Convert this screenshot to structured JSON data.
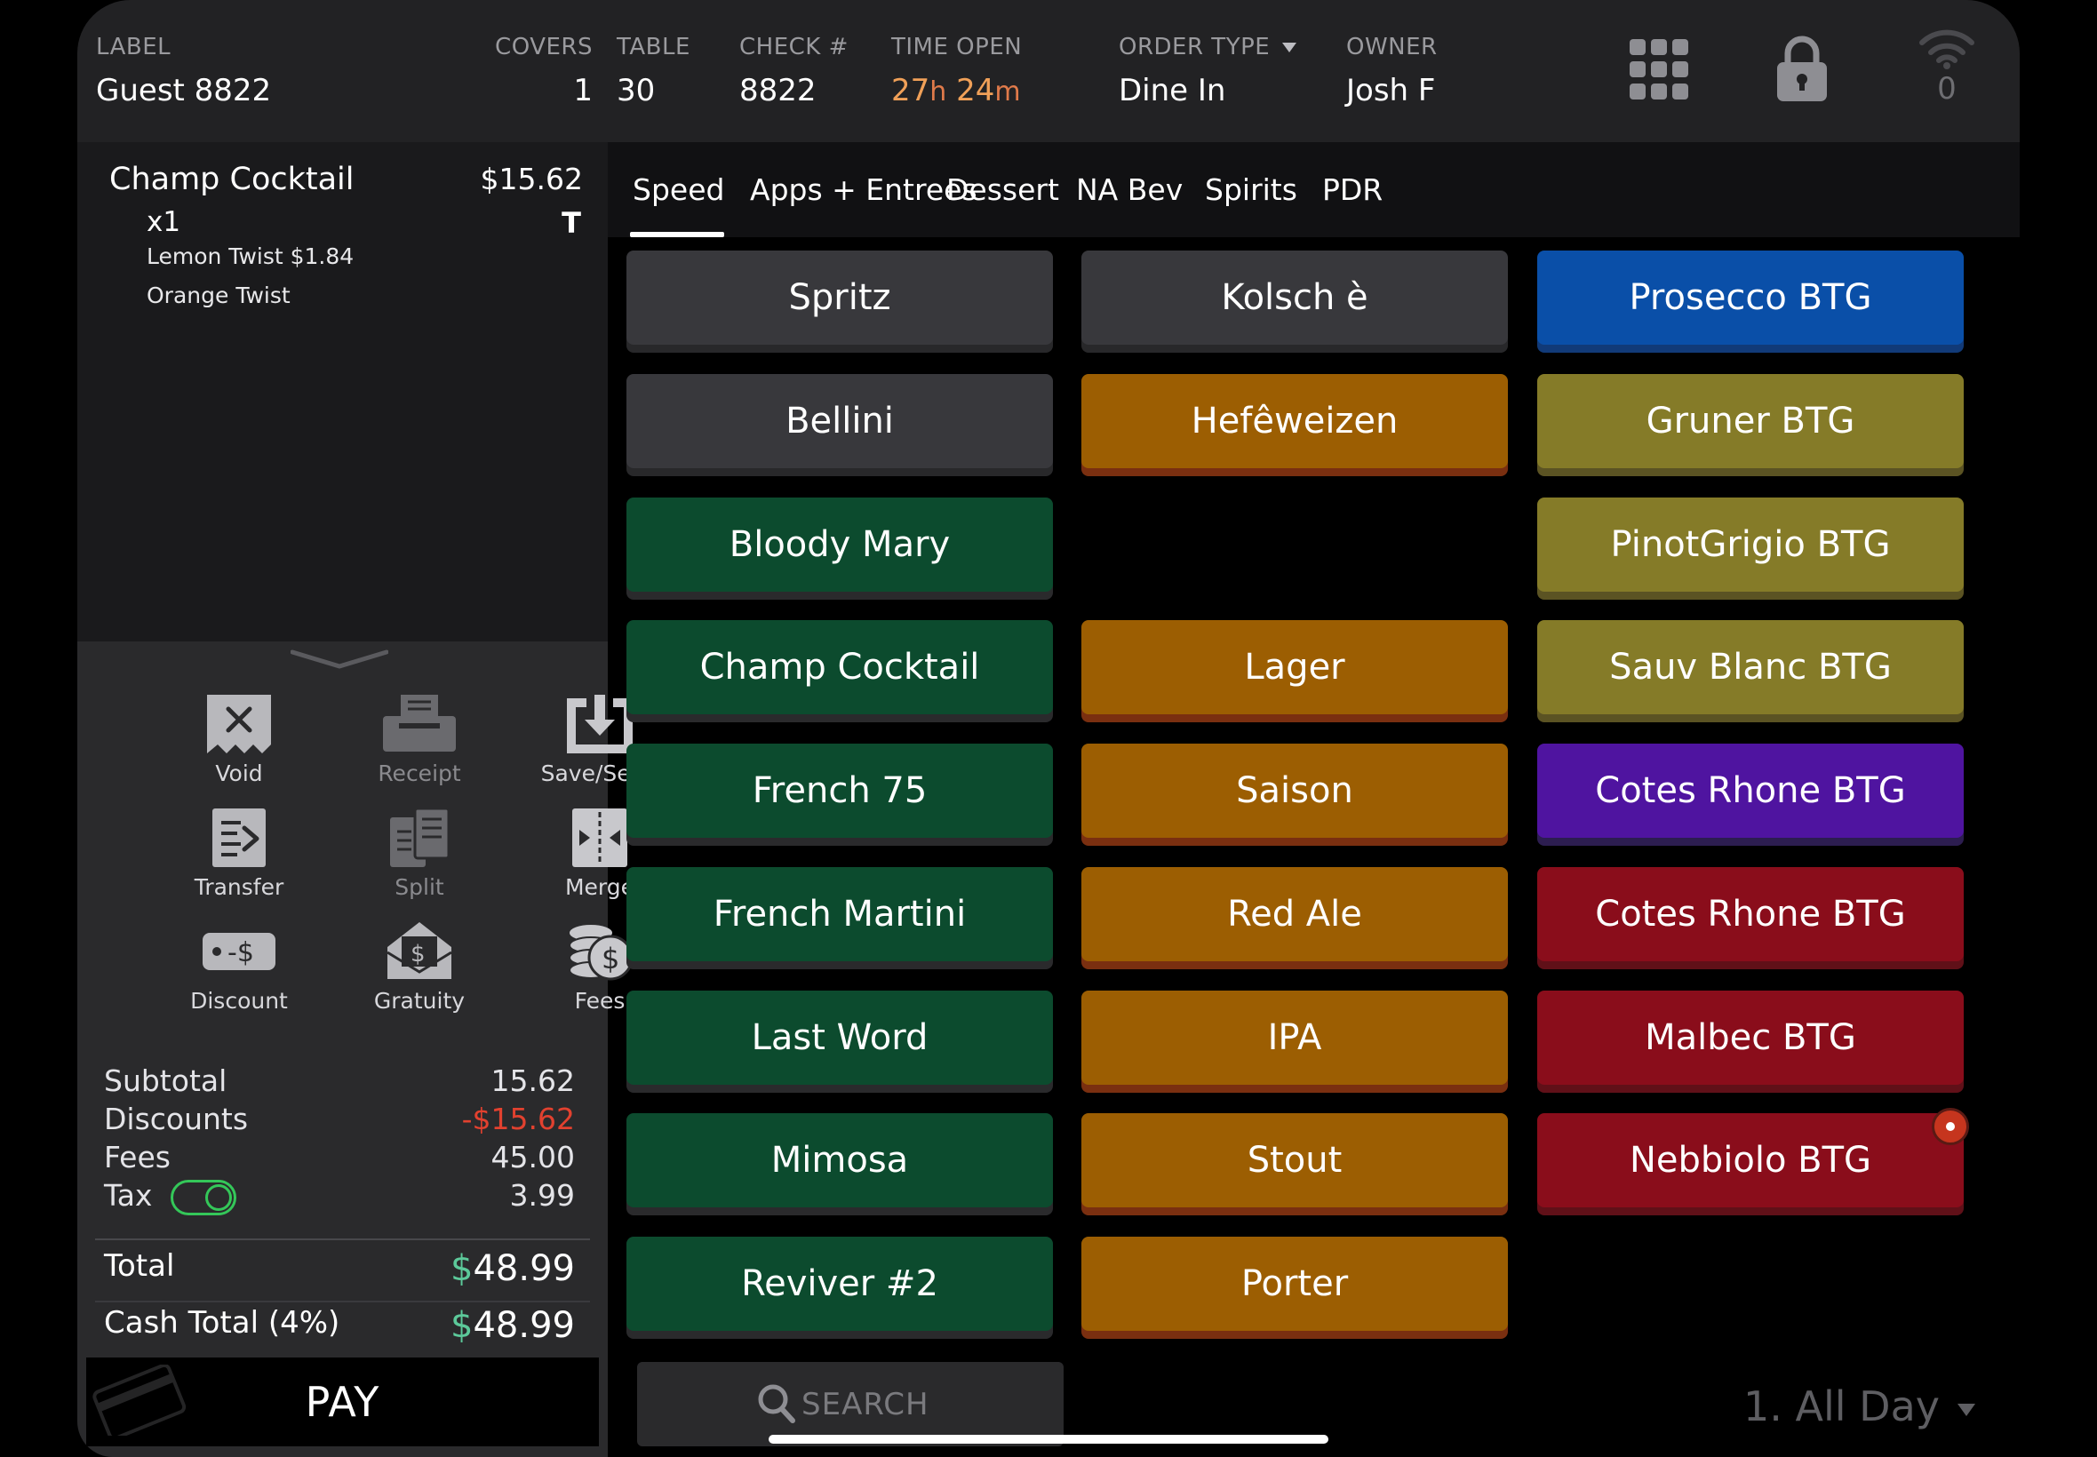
{
  "header": {
    "label": {
      "title": "LABEL",
      "value": "Guest 8822"
    },
    "covers": {
      "title": "COVERS",
      "value": "1"
    },
    "table": {
      "title": "TABLE",
      "value": "30"
    },
    "check": {
      "title": "CHECK #",
      "value": "8822"
    },
    "time_open": {
      "title": "TIME OPEN",
      "hours": "27",
      "h_unit": "h",
      "minutes": "24",
      "m_unit": "m"
    },
    "order_type": {
      "title": "ORDER TYPE",
      "value": "Dine In"
    },
    "owner": {
      "title": "OWNER",
      "value": "Josh F"
    },
    "wifi_count": "0",
    "icons": [
      "grid-icon",
      "lock-icon",
      "wifi-icon"
    ]
  },
  "order": {
    "items": [
      {
        "name": "Champ Cocktail",
        "price": "$15.62",
        "qty": "x1",
        "flag": "T",
        "modifiers": [
          "Lemon Twist $1.84",
          "Orange Twist"
        ]
      }
    ]
  },
  "actions": [
    {
      "label": "Void",
      "icon": "void-icon",
      "enabled": true
    },
    {
      "label": "Receipt",
      "icon": "receipt-icon",
      "enabled": false
    },
    {
      "label": "Save/Send",
      "icon": "save-send-icon",
      "enabled": true
    },
    {
      "label": "Transfer",
      "icon": "transfer-icon",
      "enabled": true
    },
    {
      "label": "Split",
      "icon": "split-icon",
      "enabled": false
    },
    {
      "label": "Merge",
      "icon": "merge-icon",
      "enabled": true
    },
    {
      "label": "Discount",
      "icon": "discount-icon",
      "enabled": true
    },
    {
      "label": "Gratuity",
      "icon": "gratuity-icon",
      "enabled": true
    },
    {
      "label": "Fees",
      "icon": "fees-icon",
      "enabled": true
    }
  ],
  "totals": {
    "subtotal": {
      "label": "Subtotal",
      "value": "15.62"
    },
    "discounts": {
      "label": "Discounts",
      "value": "-$15.62"
    },
    "fees": {
      "label": "Fees",
      "value": "45.00"
    },
    "tax": {
      "label": "Tax",
      "value": "3.99",
      "enabled": true
    },
    "total": {
      "label": "Total",
      "currency": "$",
      "value": "48.99"
    },
    "cash_total": {
      "label": "Cash Total (4%)",
      "currency": "$",
      "value": "48.99"
    }
  },
  "pay_label": "PAY",
  "tabs": [
    {
      "label": "Speed",
      "active": true
    },
    {
      "label": "Apps + Entrees"
    },
    {
      "label": "Dessert"
    },
    {
      "label": "NA Bev"
    },
    {
      "label": "Spirits"
    },
    {
      "label": "PDR"
    }
  ],
  "menu": {
    "col1": [
      "Spritz",
      "Bellini",
      "Bloody Mary",
      "Champ Cocktail",
      "French 75",
      "French Martini",
      "Last Word",
      "Mimosa",
      "Reviver #2"
    ],
    "col2": [
      "Kolsch è",
      "Hefêweizen",
      "",
      "Lager",
      "Saison",
      "Red Ale",
      "IPA",
      "Stout",
      "Porter"
    ],
    "col3": [
      "Prosecco BTG",
      "Gruner BTG",
      "PinotGrigio BTG",
      "Sauv Blanc BTG",
      "Cotes Rhone BTG",
      "Cotes Rhone BTG",
      "Malbec BTG",
      "Nebbiolo BTG"
    ]
  },
  "colors": {
    "gray": "#38383c",
    "green": "#0c4b2e",
    "orange": "#9c5e02",
    "blue": "#0a4fa8",
    "olive": "#857b28",
    "purple": "#4f14a0",
    "red": "#8a0d1b",
    "accent_green": "#34c759",
    "discount_red": "#e2412f"
  },
  "search": {
    "placeholder": "SEARCH"
  },
  "daypart": "1. All Day"
}
